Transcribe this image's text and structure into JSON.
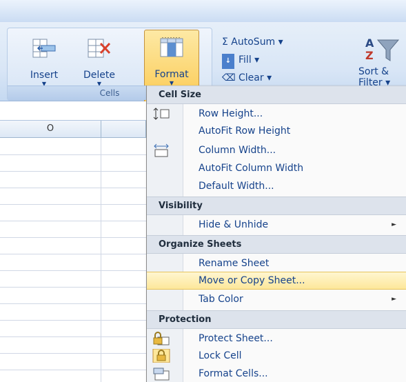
{
  "ribbon": {
    "cells_group": {
      "label": "Cells",
      "buttons": [
        {
          "label": "Insert",
          "arrow": "▼"
        },
        {
          "label": "Delete",
          "arrow": "▼"
        },
        {
          "label": "Format",
          "arrow": "▼"
        }
      ]
    },
    "editing": {
      "autosum": "Σ AutoSum ▾",
      "fill": "Fill ▾",
      "clear": "Clear ▾",
      "sort_filter": "Sort &\nFilter ▾"
    }
  },
  "sheet": {
    "column_header": "O"
  },
  "menu": {
    "sections": [
      {
        "title": "Cell Size"
      },
      {
        "title": "Visibility"
      },
      {
        "title": "Organize Sheets"
      },
      {
        "title": "Protection"
      }
    ],
    "items": [
      {
        "label": "Row Height..."
      },
      {
        "label": "AutoFit Row Height"
      },
      {
        "label": "Column Width..."
      },
      {
        "label": "AutoFit Column Width"
      },
      {
        "label": "Default Width..."
      },
      {
        "label": "Hide & Unhide",
        "submenu": "►"
      },
      {
        "label": "Rename Sheet"
      },
      {
        "label": "Move or Copy Sheet..."
      },
      {
        "label": "Tab Color",
        "submenu": "►"
      },
      {
        "label": "Protect Sheet..."
      },
      {
        "label": "Lock Cell"
      },
      {
        "label": "Format Cells..."
      }
    ]
  },
  "colors": {
    "ribbon_text": "#15428b",
    "highlight": "#fde79a",
    "section_bg": "#dde3ec"
  }
}
